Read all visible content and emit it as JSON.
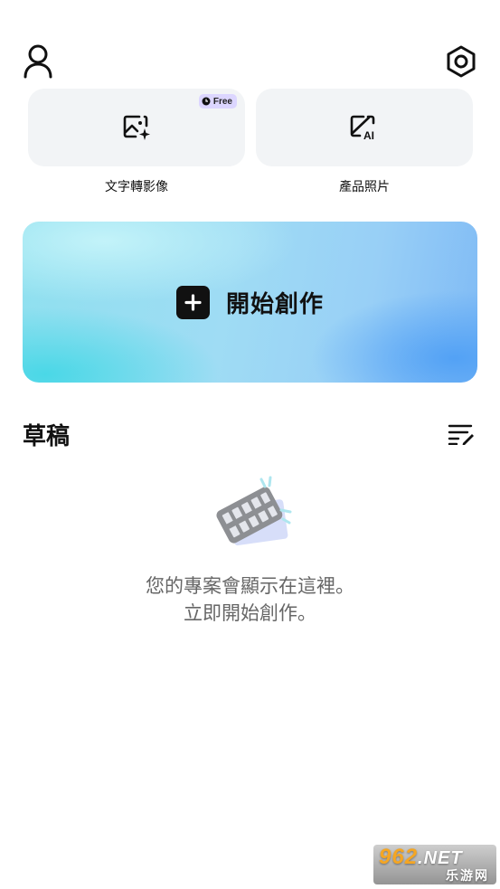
{
  "header": {
    "profile_icon": "person-outline-icon",
    "settings_icon": "hexagon-gear-icon"
  },
  "tools": [
    {
      "label": "文字轉影像",
      "icon": "image-sparkle-icon",
      "badge": "Free"
    },
    {
      "label": "產品照片",
      "icon": "ai-photo-edit-icon"
    }
  ],
  "hero": {
    "label": "開始創作",
    "icon": "plus-square-icon",
    "colors": [
      "#8fe0ef",
      "#7fbaf5"
    ]
  },
  "drafts": {
    "title": "草稿",
    "menu_icon": "list-edit-icon",
    "empty_illustration": "film-strip-icon",
    "empty_line1": "您的專案會顯示在這裡。",
    "empty_line2": "立即開始創作。"
  },
  "watermark": {
    "brand": "962",
    "domain": ".NET",
    "site": "乐游网"
  }
}
